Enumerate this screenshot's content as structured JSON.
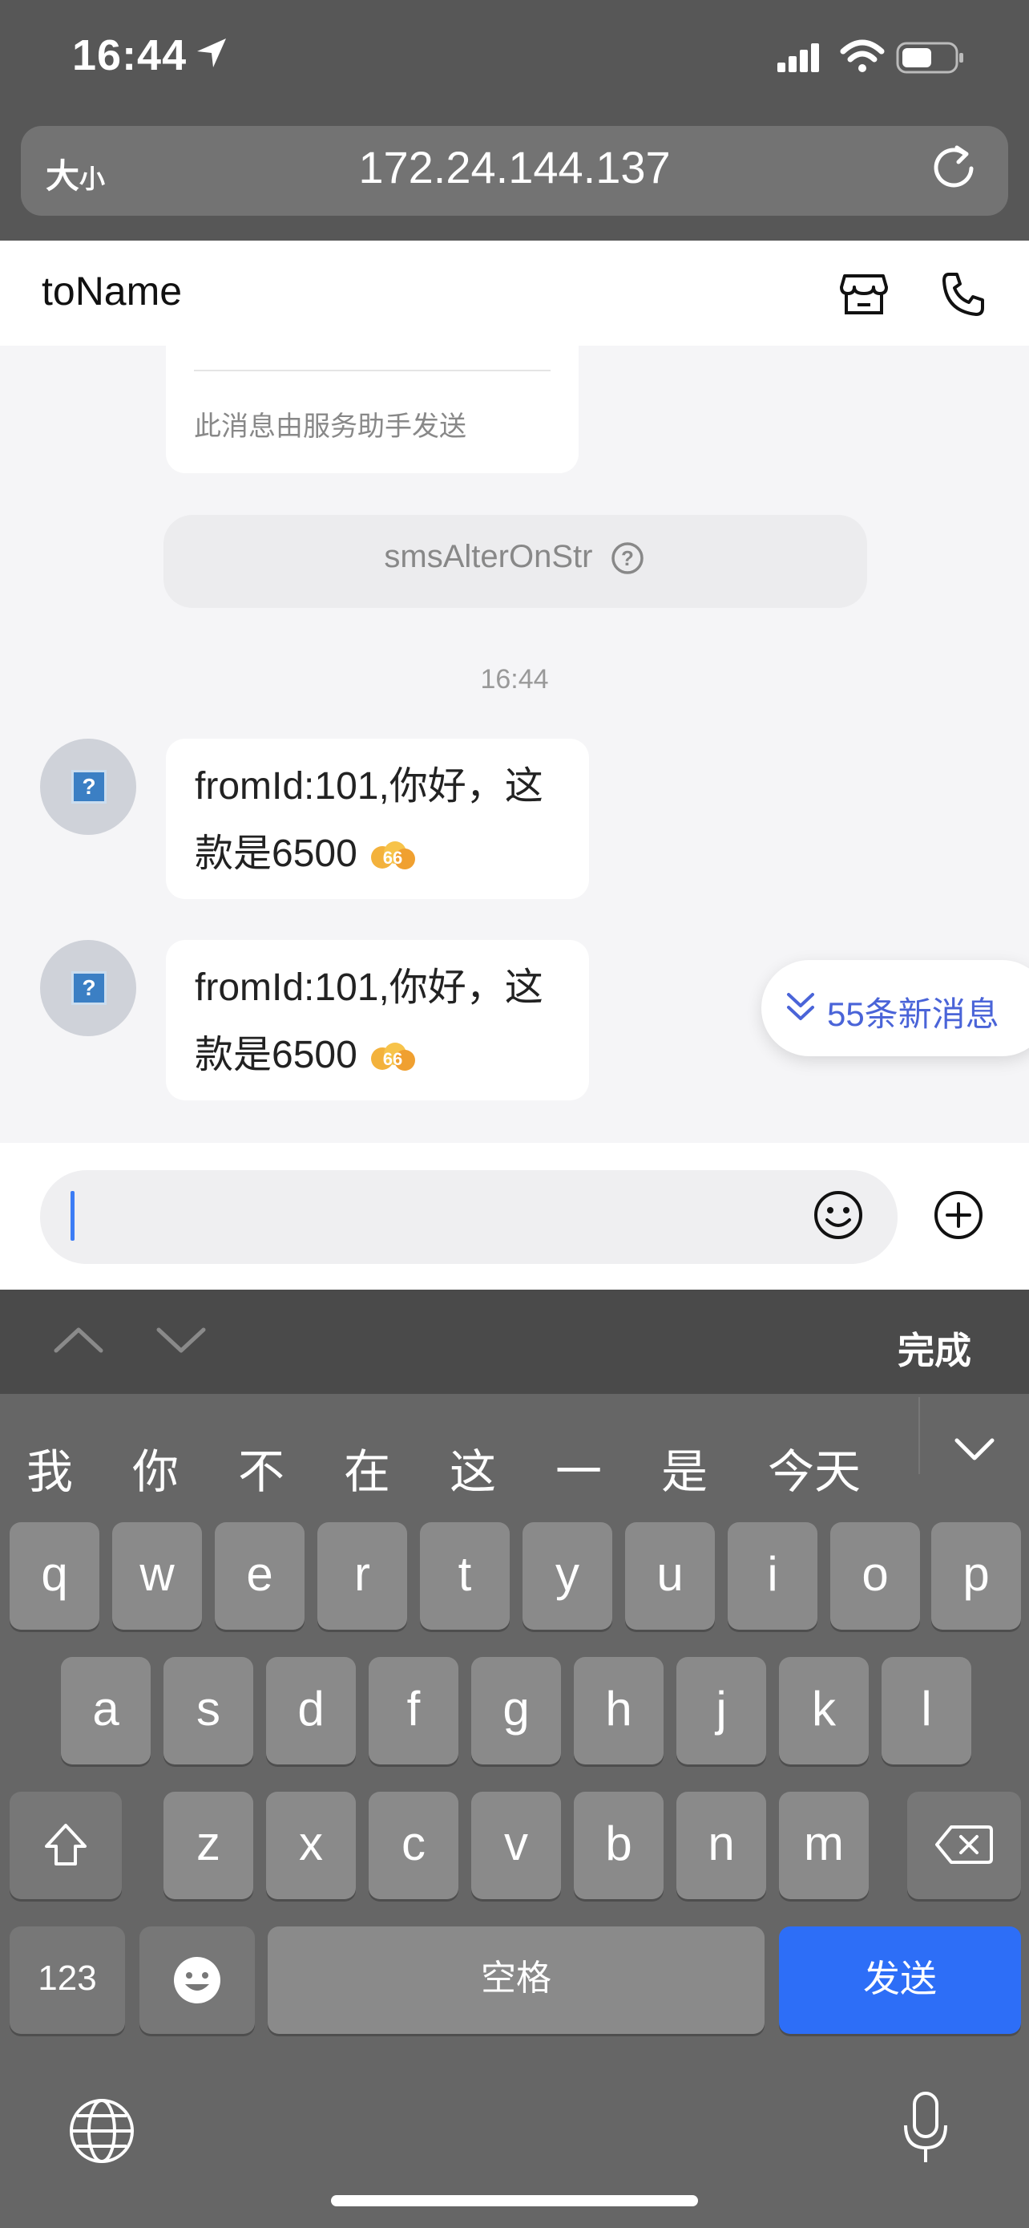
{
  "status_bar": {
    "time": "16:44"
  },
  "browser": {
    "text_size_label": "大",
    "text_size_small": "小",
    "url": "172.24.144.137"
  },
  "header": {
    "title": "toName"
  },
  "chat": {
    "system_card_text": "此消息由服务助手发送",
    "notice_text": "smsAlterOnStr",
    "timestamp": "16:44",
    "messages": [
      {
        "text_line1": "fromId:101,你好，这",
        "text_line2": "款是6500"
      },
      {
        "text_line1": "fromId:101,你好，这",
        "text_line2": "款是6500"
      }
    ],
    "new_messages_label": "55条新消息"
  },
  "input": {
    "value": ""
  },
  "keyboard": {
    "done_label": "完成",
    "candidates": [
      "我",
      "你",
      "不",
      "在",
      "这",
      "一",
      "是",
      "今天"
    ],
    "row1": [
      "q",
      "w",
      "e",
      "r",
      "t",
      "y",
      "u",
      "i",
      "o",
      "p"
    ],
    "row2": [
      "a",
      "s",
      "d",
      "f",
      "g",
      "h",
      "j",
      "k",
      "l"
    ],
    "row3": [
      "z",
      "x",
      "c",
      "v",
      "b",
      "n",
      "m"
    ],
    "numbers_label": "123",
    "space_label": "空格",
    "send_label": "发送"
  },
  "colors": {
    "accent": "#2d6ef7",
    "new_msg": "#4a64d8"
  }
}
